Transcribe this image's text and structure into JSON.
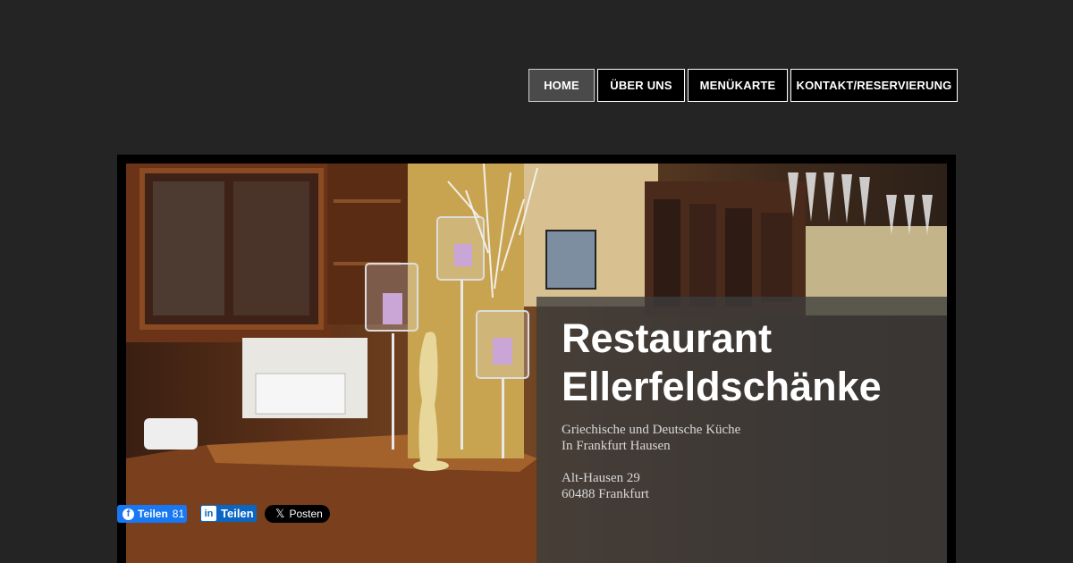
{
  "nav": {
    "items": [
      {
        "label": "HOME",
        "active": true
      },
      {
        "label": "ÜBER UNS",
        "active": false
      },
      {
        "label": "MENÜKARTE",
        "active": false
      },
      {
        "label": "KONTAKT/RESERVIERUNG",
        "active": false
      }
    ]
  },
  "hero": {
    "title_line1": "Restaurant",
    "title_line2": "Ellerfeldschänke",
    "subtitle_line1": "Griechische und Deutsche Küche",
    "subtitle_line2": "In Frankfurt Hausen",
    "address_line1": "Alt-Hausen 29",
    "address_line2": "60488 Frankfurt"
  },
  "share": {
    "facebook": {
      "label": "Teilen",
      "count": "81",
      "icon": "facebook-icon",
      "color": "#1877f2"
    },
    "linkedin": {
      "label": "Teilen",
      "icon": "linkedin-icon",
      "color": "#0a66c2"
    },
    "x": {
      "label": "Posten",
      "icon": "x-icon",
      "color": "#000000"
    }
  },
  "colors": {
    "background": "#242424",
    "nav_background": "#000000",
    "nav_active": "#4a4a4a"
  }
}
